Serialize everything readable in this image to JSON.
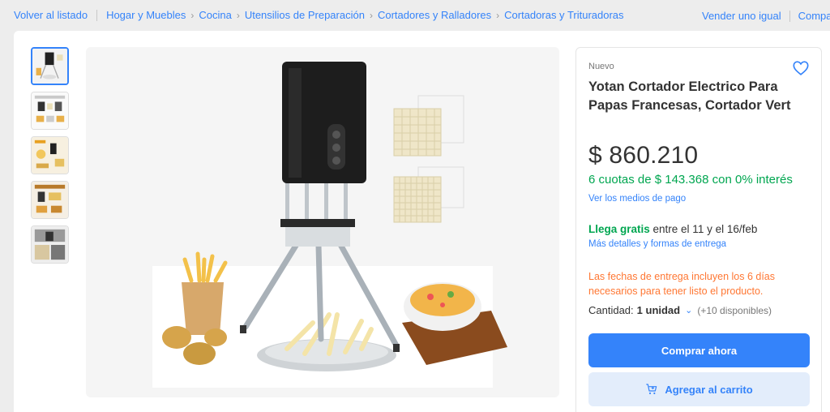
{
  "breadcrumb": {
    "back_label": "Volver al listado",
    "items": [
      "Hogar y Muebles",
      "Cocina",
      "Utensilios de Preparación",
      "Cortadores y Ralladores",
      "Cortadoras y Trituradoras"
    ]
  },
  "header_links": {
    "sell_label": "Vender uno igual",
    "share_label": "Compartir"
  },
  "gallery": {
    "thumbnail_count": 5,
    "selected_index": 0
  },
  "product": {
    "condition": "Nuevo",
    "title": "Yotan Cortador Electrico Para Papas Francesas, Cortador Vert",
    "price": "$ 860.210",
    "installments": "6 cuotas de $ 143.368 con 0% interés",
    "payment_link": "Ver los medios de pago",
    "shipping_free": "Llega gratis",
    "shipping_dates": " entre el 11 y el 16/feb",
    "shipping_link": "Más detalles y formas de entrega",
    "delivery_notice": "Las fechas de entrega incluyen los 6 días necesarios para tener listo el producto.",
    "quantity_label": "Cantidad:",
    "quantity_value": "1 unidad",
    "quantity_available": "(+10 disponibles)",
    "buy_button": "Comprar ahora",
    "cart_button": "Agregar al carrito"
  },
  "colors": {
    "accent": "#3483fa",
    "success": "#00a650",
    "warning": "#ff7733"
  },
  "icons": [
    "heart-icon",
    "cart-icon",
    "chevron-down-icon",
    "chevron-right-icon"
  ]
}
